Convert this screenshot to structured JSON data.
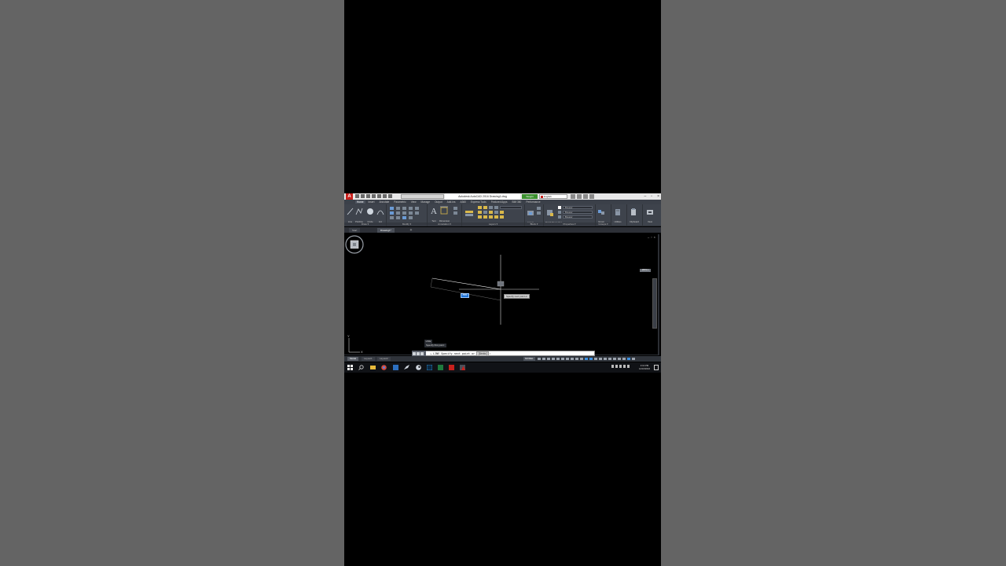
{
  "window": {
    "app_title": "Autodesk AutoCAD 2016   Drawing1.dwg",
    "search_label": "Weight",
    "signin_label": "English",
    "controls": [
      "–",
      "▫",
      "×"
    ]
  },
  "ribbon": {
    "tabs": [
      "Home",
      "Insert",
      "Annotate",
      "Parametric",
      "View",
      "Manage",
      "Output",
      "Add-ins",
      "A360",
      "Express Tools",
      "Featured Apps",
      "BIM 360",
      "Performance"
    ],
    "active_tab": "Home",
    "draw": {
      "title": "Draw ▾",
      "tools": [
        "Line",
        "Polyline",
        "Circle",
        "Arc"
      ]
    },
    "modify": {
      "title": "Modify ▾"
    },
    "annotation": {
      "title": "Annotation ▾",
      "tools": [
        "Text",
        "Dimension"
      ]
    },
    "layers": {
      "title": "Layers ▾",
      "tools": [
        "Layer Properties"
      ]
    },
    "block": {
      "title": "Block ▾",
      "tools": [
        "Insert"
      ]
    },
    "properties": {
      "title": "Properties ▾",
      "tools": [
        "Match Properties"
      ],
      "combos": [
        "ByLayer",
        "ByLayer",
        "ByLayer"
      ]
    },
    "groups": {
      "title": "Groups ▾",
      "tools": [
        "Group"
      ]
    },
    "utilities": {
      "tools": [
        "Utilities"
      ]
    },
    "clipboard": {
      "tools": [
        "Clipboard"
      ]
    },
    "view": {
      "tools": [
        "View"
      ]
    }
  },
  "file_tabs": [
    "Start",
    "Drawing1*"
  ],
  "viewport": {
    "window_controls": [
      "–",
      "▫",
      "×"
    ],
    "wcs_label": "WCS ▾",
    "tooltip": "Specify next point or",
    "dyn_input_a": "0",
    "dyn_input_b": "8883"
  },
  "command": {
    "history_1": "LINE",
    "history_2": "Specify first point:",
    "prompt_prefix": "↘ LINE Specify next point or ",
    "prompt_option": "[Undo]",
    "prompt_suffix": ":"
  },
  "layout_tabs": [
    "Model",
    "Layout1",
    "Layout2"
  ],
  "status": {
    "model": "MODEL"
  },
  "taskbar": {
    "time": "3:13 PM",
    "date": "12/16/2016"
  },
  "colors": {
    "accent": "#1e73d8",
    "autocad_red": "#c8201c",
    "ribbon_bg": "#3e434c"
  }
}
